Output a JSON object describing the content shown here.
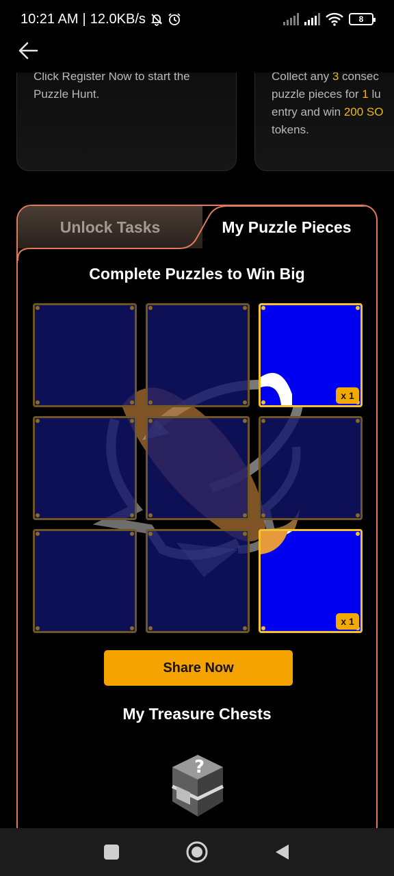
{
  "status_bar": {
    "time": "10:21 AM",
    "separator": "|",
    "speed": "12.0KB/s",
    "battery": "8"
  },
  "header": {
    "back_icon": "arrow-left-icon"
  },
  "top_cards": {
    "card1": {
      "line1": "Click Register Now to start the",
      "line2": "Puzzle Hunt."
    },
    "card2": {
      "line1_pre": "Collect any ",
      "line1_num": "3",
      "line1_post": " consec",
      "line2_pre": "puzzle pieces for ",
      "line2_num": "1",
      "line2_post": " lu",
      "line3_pre": "entry and win ",
      "line3_hl": "200 SO",
      "line4": "tokens."
    }
  },
  "tabs": {
    "unlock_tasks": "Unlock Tasks",
    "my_puzzle_pieces": "My Puzzle Pieces",
    "active": "my_puzzle_pieces"
  },
  "puzzle": {
    "title": "Complete Puzzles to Win Big",
    "pieces": [
      {
        "owned": false,
        "count": ""
      },
      {
        "owned": false,
        "count": ""
      },
      {
        "owned": true,
        "count": "x 1"
      },
      {
        "owned": false,
        "count": ""
      },
      {
        "owned": false,
        "count": ""
      },
      {
        "owned": false,
        "count": ""
      },
      {
        "owned": false,
        "count": ""
      },
      {
        "owned": false,
        "count": ""
      },
      {
        "owned": true,
        "count": "x 1"
      }
    ],
    "share_button": "Share Now"
  },
  "chests": {
    "title": "My Treasure Chests",
    "icon": "mystery-chest-icon"
  },
  "nav": {
    "recents_icon": "square-icon",
    "home_icon": "circle-icon",
    "back_icon": "triangle-back-icon"
  },
  "colors": {
    "accent": "#f5a300",
    "panel_border": "#e07a57",
    "owned_piece": "#0000f0",
    "locked_piece": "#12146e"
  }
}
